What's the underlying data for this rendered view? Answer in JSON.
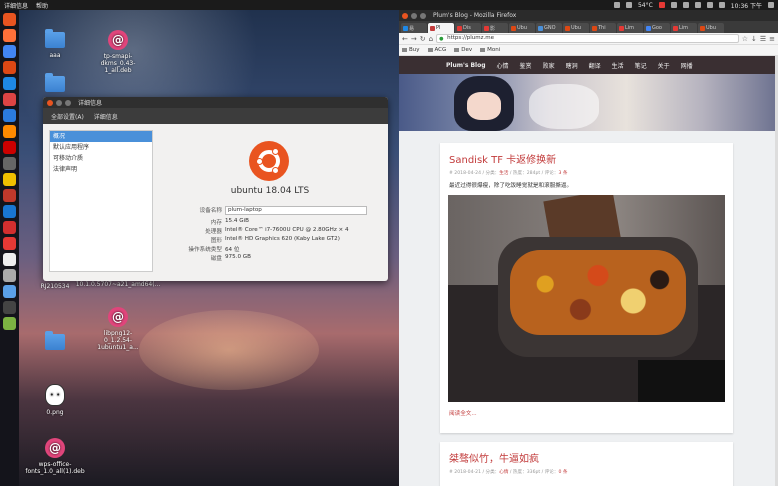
{
  "top_panel": {
    "menu": [
      "详细信息",
      "帮助"
    ],
    "temperature": "54°C",
    "datetime": "10:36 下午"
  },
  "launcher": {
    "colors": [
      "#e95420",
      "#ff7139",
      "#4285f4",
      "#dd4814",
      "#1e88e5",
      "#d44",
      "#2b7bde",
      "#ff8a00",
      "#c00",
      "#666",
      "#f0c000",
      "#c0392b",
      "#1976d2",
      "#d32f2f",
      "#e53935",
      "#eee",
      "#aaa",
      "#5aa0e8",
      "#444",
      "#7cb342"
    ]
  },
  "desktop_icons": [
    {
      "label": "aaa",
      "kind": "folder"
    },
    {
      "label": "tp-smapi-dkms_0.43-1_all.deb",
      "kind": "deb"
    },
    {
      "label": "",
      "kind": "folder"
    },
    {
      "label": "RJ210534",
      "kind": "folder"
    },
    {
      "label": "10.1.0.5707~a21_amd64(...",
      "kind": "folder"
    },
    {
      "label": "",
      "kind": "folder"
    },
    {
      "label": "libpng12-0_1.2.54-1ubuntu1_a...",
      "kind": "deb"
    },
    {
      "label": "0.png",
      "kind": "image"
    },
    {
      "label": "wps-office-fonts_1.0_all(1).deb",
      "kind": "deb"
    }
  ],
  "settings_window": {
    "title": "详细信息",
    "toolbar": {
      "all_settings": "全部设置(A)",
      "details": "详细信息"
    },
    "sidebar": [
      "概况",
      "默认应用程序",
      "可移动介质",
      "法律声明"
    ],
    "os_name": "ubuntu 18.04 LTS",
    "rows": [
      {
        "key": "设备名称",
        "value": "plum-laptop"
      },
      {
        "key": "内存",
        "value": "15.4 GiB"
      },
      {
        "key": "处理器",
        "value": "Intel® Core™ i7-7600U CPU @ 2.80GHz × 4"
      },
      {
        "key": "图形",
        "value": "Intel® HD Graphics 620 (Kaby Lake GT2)"
      },
      {
        "key": "操作系统类型",
        "value": "64 位"
      },
      {
        "key": "磁盘",
        "value": "975.0 GB"
      }
    ]
  },
  "firefox": {
    "window_title": "Plum's Blog - Mozilla Firefox",
    "tabs": [
      {
        "label": "易",
        "color": "#1e88e5",
        "active": false
      },
      {
        "label": "Pl",
        "color": "#c23b3b",
        "active": true
      },
      {
        "label": "Dis",
        "color": "#e53935",
        "active": false
      },
      {
        "label": "影",
        "color": "#e53935",
        "active": false
      },
      {
        "label": "Ubu",
        "color": "#dd4814",
        "active": false
      },
      {
        "label": "GNO",
        "color": "#4a90d9",
        "active": false
      },
      {
        "label": "Ubu",
        "color": "#dd4814",
        "active": false
      },
      {
        "label": "Thi",
        "color": "#dd4814",
        "active": false
      },
      {
        "label": "Lim",
        "color": "#e53935",
        "active": false
      },
      {
        "label": "Goo",
        "color": "#4285f4",
        "active": false
      },
      {
        "label": "Lim",
        "color": "#e53935",
        "active": false
      },
      {
        "label": "Ubu",
        "color": "#dd4814",
        "active": false
      }
    ],
    "url": "https://plumz.me",
    "bookmarks": [
      "Buy",
      "ACG",
      "Dev",
      "Moni"
    ]
  },
  "blog": {
    "nav": [
      "Plum's Blog",
      "心情",
      "鉴赏",
      "败家",
      "瞎洞",
      "翻译",
      "生活",
      "笔记",
      "关于",
      "网播"
    ],
    "posts": [
      {
        "title": "Sandisk TF 卡返修换新",
        "meta_date": "# 2018-04-24 / 分类：",
        "meta_cat": "生活",
        "meta_rest": " / 热度：284pt / 评论：",
        "meta_count": "3 条",
        "excerpt": "最近过得很爆瘦，除了吃饭睡觉就是和滚服撕逼。",
        "readmore": "阅读全文..."
      },
      {
        "title": "桀骜似竹，牛逼如疯",
        "meta_date": "# 2018-04-21 / 分类：",
        "meta_cat": "心情",
        "meta_rest": " / 热度：336pt / 评论：",
        "meta_count": "0 条"
      }
    ]
  }
}
